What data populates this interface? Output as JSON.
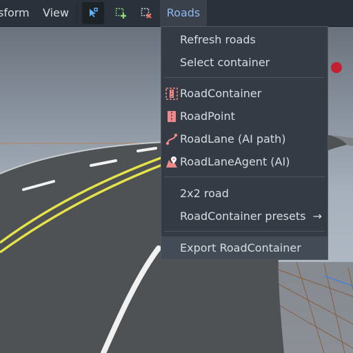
{
  "toolbar": {
    "transform_label": "sform",
    "view_label": "View",
    "icons": {
      "select": "select-road-icon",
      "add": "add-road-point-icon",
      "remove": "remove-road-point-icon"
    },
    "roads_label": "Roads"
  },
  "menu": {
    "items": [
      {
        "label": "Refresh roads"
      },
      {
        "label": "Select container"
      },
      {
        "label": "RoadContainer",
        "icon": "road-container-icon"
      },
      {
        "label": "RoadPoint",
        "icon": "road-point-icon"
      },
      {
        "label": "RoadLane (AI path)",
        "icon": "road-lane-icon"
      },
      {
        "label": "RoadLaneAgent (AI)",
        "icon": "road-lane-agent-icon"
      },
      {
        "label": "2x2 road"
      },
      {
        "label": "RoadContainer presets",
        "submenu_arrow": "→"
      },
      {
        "label": "Export RoadContainer"
      }
    ]
  },
  "colors": {
    "toolbar_bg": "#2b313a",
    "menu_bg": "#343b45",
    "accent_text": "#8fb8f0",
    "icon_pink": "#f08a8a",
    "road_yellow": "#e6e34a"
  }
}
